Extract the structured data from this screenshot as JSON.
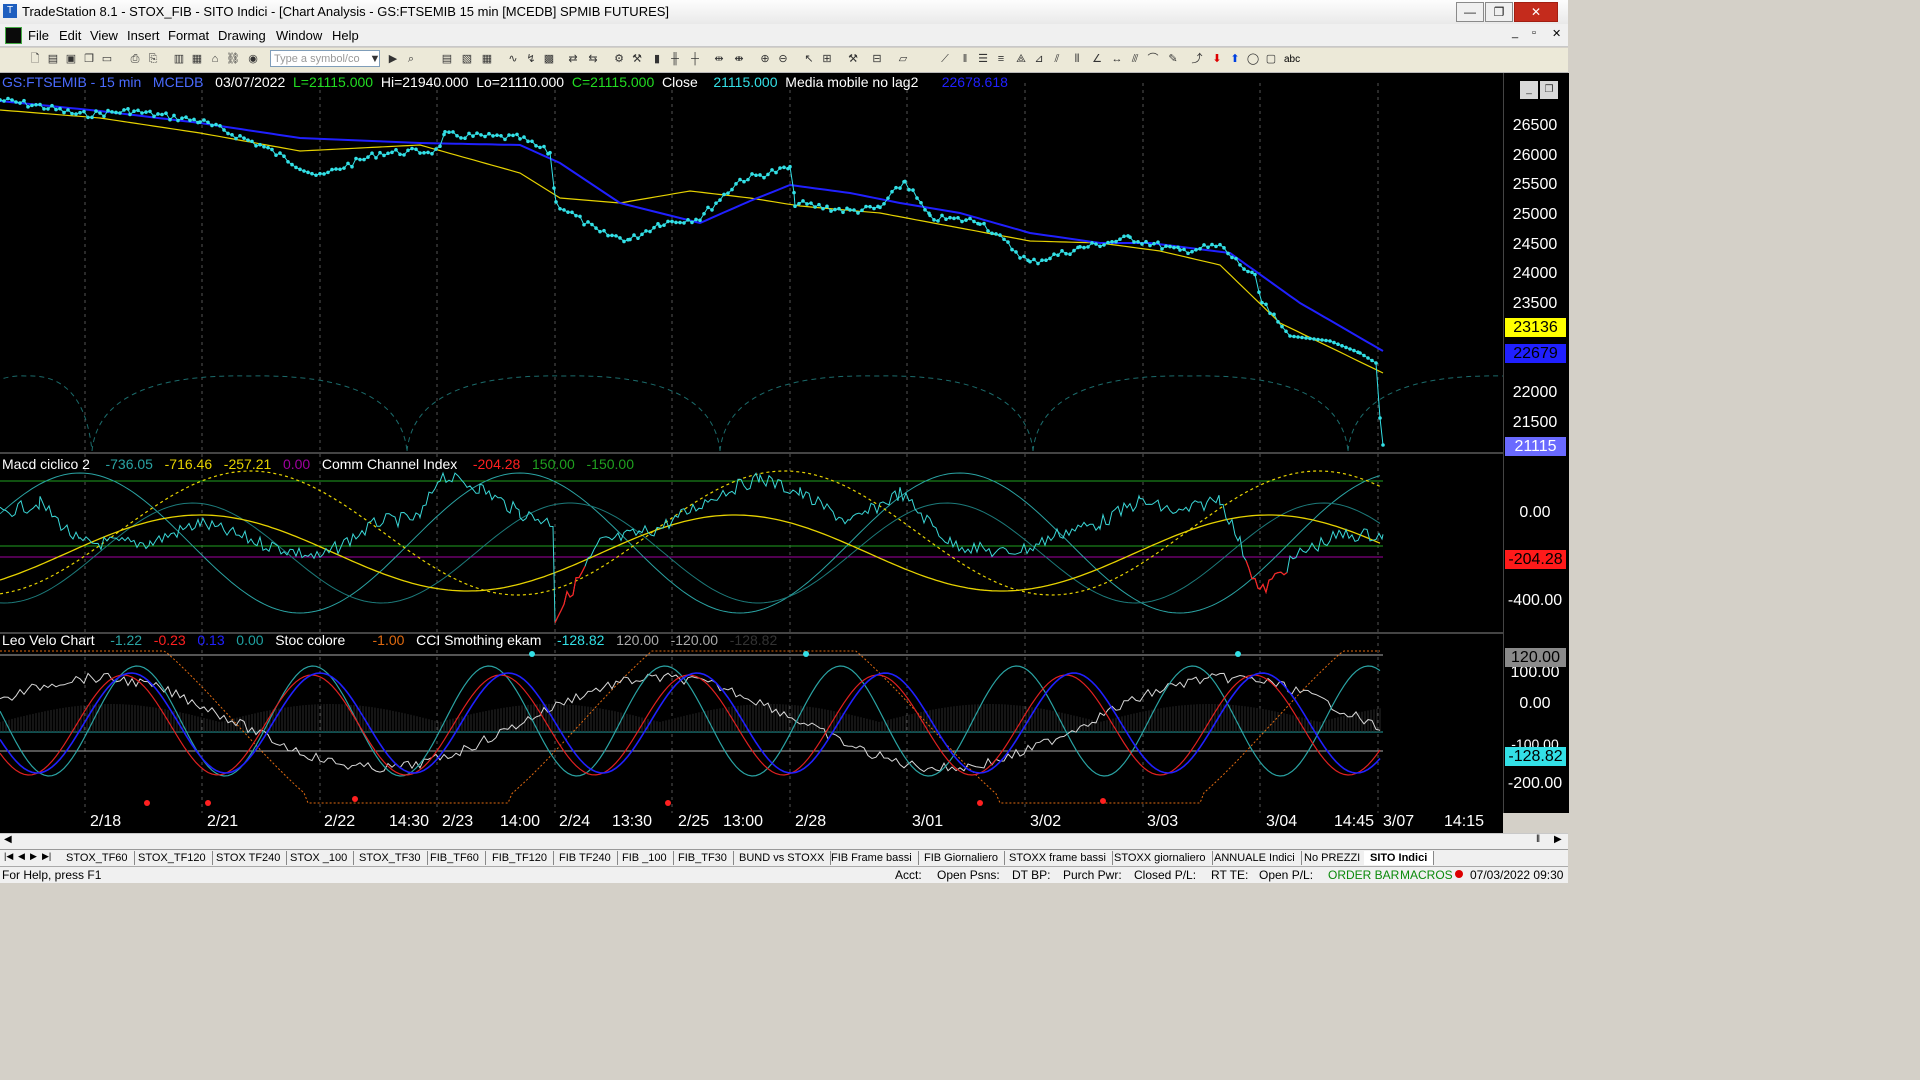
{
  "window": {
    "title": "TradeStation 8.1 - STOX_FIB - SITO Indici - [Chart Analysis - GS:FTSEMIB  15 min  [MCEDB] SPMIB FUTURES]",
    "min": "—",
    "max": "❐",
    "close": "✕"
  },
  "menu": [
    "File",
    "Edit",
    "View",
    "Insert",
    "Format",
    "Drawing",
    "Window",
    "Help"
  ],
  "toolbar": {
    "symbol_placeholder": "Type a symbol/co",
    "text_tool": "abc"
  },
  "price_panel": {
    "symbol": "GS:FTSEMIB - 15 min",
    "exchange": "MCEDB",
    "date": "03/07/2022",
    "low_label": "L=21115.000",
    "hi_label": "Hi=21940.000",
    "lo_label": "Lo=21110.000",
    "close_label": "C=21115.000",
    "close_word": "Close",
    "close_value": "21115.000",
    "ma_label": "Media mobile no lag2",
    "ma_value": "22678.618",
    "axis_ticks": [
      "26500",
      "26000",
      "25500",
      "25000",
      "24500",
      "24000",
      "23500",
      "23000",
      "22500",
      "22000",
      "21500"
    ],
    "badge_yellow": "23136",
    "badge_blue": "22679",
    "badge_last": "21115"
  },
  "macd_panel": {
    "label1": "Macd ciclico 2",
    "v1": "-736.05",
    "v2": "-716.46",
    "v3": "-257.21",
    "v4": "0.00",
    "label2": "Comm Channel Index",
    "v5": "-204.28",
    "v6": "150.00",
    "v7": "-150.00",
    "axis_ticks": [
      "0.00",
      "-400.00"
    ],
    "badge_red": "-204.28"
  },
  "leo_panel": {
    "label1": "Leo Velo Chart",
    "v1": "-1.22",
    "v2": "-0.23",
    "v3": "0.13",
    "v4": "0.00",
    "label2": "Stoc colore",
    "v5": "-1.00",
    "label3": "CCI Smothing ekam",
    "v6": "-128.82",
    "v7": "120.00",
    "v8": "-120.00",
    "v9": "-128.82",
    "axis_ticks": [
      "100.00",
      "0.00",
      "-100.00",
      "-200.00"
    ],
    "badge_grey": "120.00",
    "badge_cyan": "-128.82"
  },
  "time_labels": [
    "2/18",
    "2/21",
    "2/22",
    "14:30",
    "2/23",
    "14:00",
    "2/24",
    "13:30",
    "2/25",
    "13:00",
    "2/28",
    "3/01",
    "3/02",
    "3/03",
    "3/04",
    "14:45",
    "3/07",
    "14:15"
  ],
  "tabs": [
    "STOX_TF60",
    "STOX_TF120",
    "STOX TF240",
    "STOX _100",
    "STOX_TF30",
    "FIB_TF60",
    "FIB_TF120",
    "FIB TF240",
    "FIB _100",
    "FIB_TF30",
    "BUND vs STOXX",
    "FIB Frame bassi",
    "FIB Giornaliero",
    "STOXX frame bassi",
    "STOXX giornaliero",
    "ANNUALE Indici",
    "No PREZZI",
    "SITO Indici"
  ],
  "status": {
    "help": "For Help, press F1",
    "acct": "Acct:",
    "open_psns": "Open Psns:",
    "dt_bp": "DT BP:",
    "purch_pwr": "Purch Pwr:",
    "closed_pl": "Closed P/L:",
    "rt_te": "RT TE:",
    "open_pl": "Open P/L:",
    "order_bar": "ORDER BAR",
    "macros": "MACROS",
    "datetime": "07/03/2022 09:30"
  },
  "colors": {
    "price_dots": "#33e0e6",
    "ma_blue": "#2020ff",
    "ma_yellow": "#e6d200",
    "cci_red": "#ff2020",
    "cycle_teal": "#1b6b6b"
  }
}
